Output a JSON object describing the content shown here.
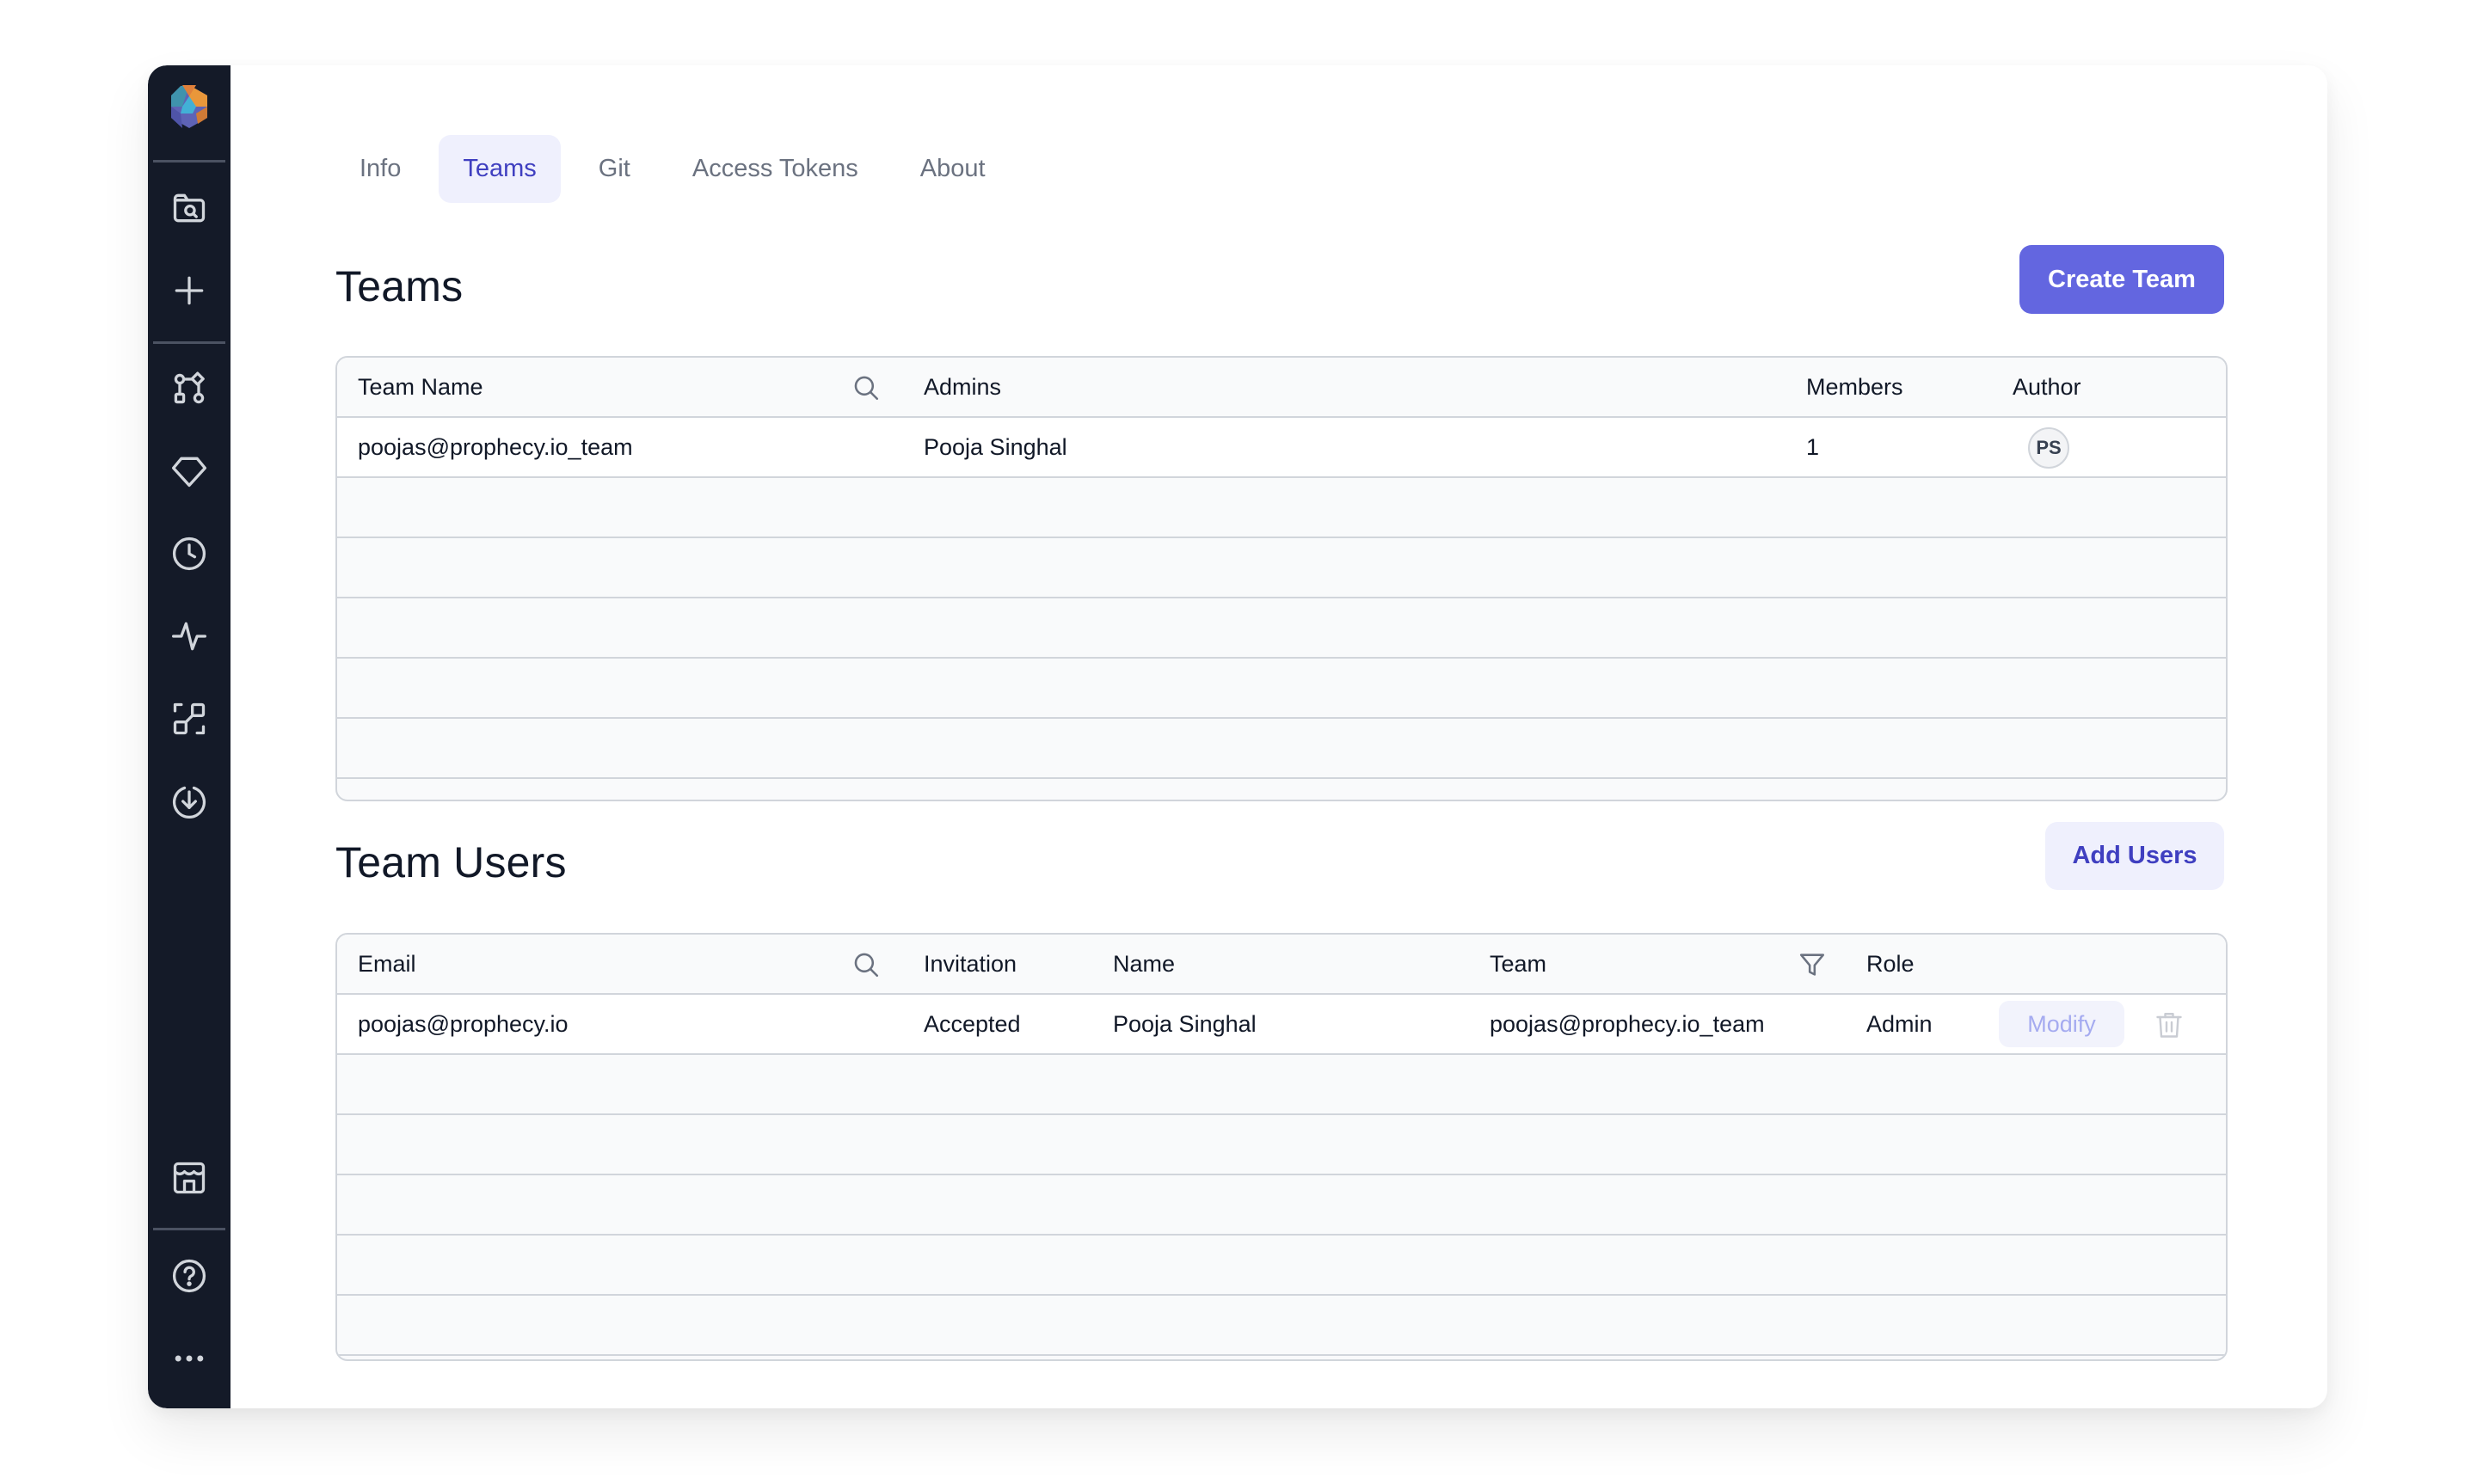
{
  "colors": {
    "sidebar_bg": "#141a28",
    "primary": "#6366e0",
    "active_tab_bg": "#eff0fd",
    "active_tab_text": "#3f3fc0",
    "table_border": "#d1d5db",
    "muted_text": "#6b7280"
  },
  "sidebar": {
    "logo": "prophecy-logo",
    "top_items": [
      {
        "icon": "folder-search-icon",
        "label": "Browse"
      },
      {
        "icon": "plus-icon",
        "label": "Create"
      }
    ],
    "middle_items": [
      {
        "icon": "pipeline-icon",
        "label": "Pipelines"
      },
      {
        "icon": "gem-icon",
        "label": "Gems"
      },
      {
        "icon": "clock-icon",
        "label": "Jobs"
      },
      {
        "icon": "activity-icon",
        "label": "Observability"
      },
      {
        "icon": "lineage-icon",
        "label": "Lineage"
      },
      {
        "icon": "download-icon",
        "label": "Download"
      }
    ],
    "bottom_items": [
      {
        "icon": "marketplace-icon",
        "label": "Marketplace"
      },
      {
        "icon": "help-icon",
        "label": "Help"
      },
      {
        "icon": "more-icon",
        "label": "More"
      }
    ]
  },
  "tabs": [
    {
      "label": "Info",
      "active": false
    },
    {
      "label": "Teams",
      "active": true
    },
    {
      "label": "Git",
      "active": false
    },
    {
      "label": "Access Tokens",
      "active": false
    },
    {
      "label": "About",
      "active": false
    }
  ],
  "teams_section": {
    "title": "Teams",
    "create_button": "Create Team",
    "columns": [
      "Team Name",
      "Admins",
      "Members",
      "Author"
    ],
    "rows": [
      {
        "team_name": "poojas@prophecy.io_team",
        "admins": "Pooja Singhal",
        "members": "1",
        "author_initials": "PS"
      }
    ]
  },
  "team_users_section": {
    "title": "Team Users",
    "add_button": "Add Users",
    "columns": [
      "Email",
      "Invitation",
      "Name",
      "Team",
      "Role"
    ],
    "rows": [
      {
        "email": "poojas@prophecy.io",
        "invitation": "Accepted",
        "name": "Pooja Singhal",
        "team": "poojas@prophecy.io_team",
        "role": "Admin",
        "modify_label": "Modify"
      }
    ]
  }
}
